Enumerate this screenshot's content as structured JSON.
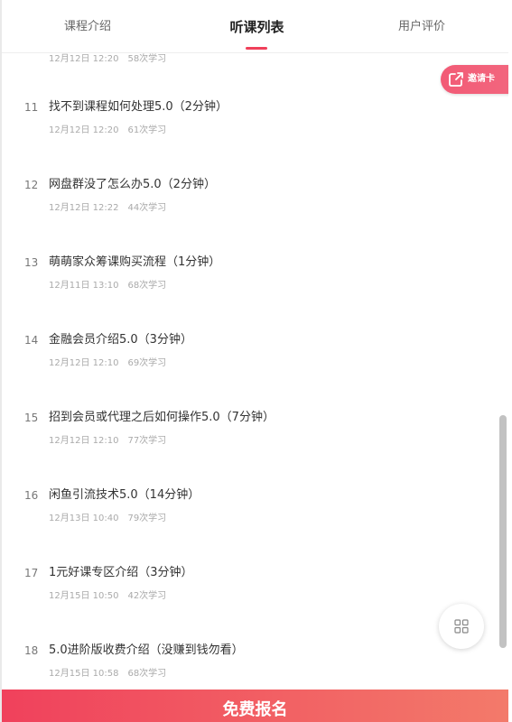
{
  "tabs": {
    "intro": "课程介绍",
    "list": "听课列表",
    "reviews": "用户评价",
    "active": "list"
  },
  "invite": {
    "label": "邀请卡",
    "icon": "share-icon"
  },
  "enroll": {
    "label": "免费报名"
  },
  "colors": {
    "accent": "#f0405a",
    "enroll_start": "#f0415c",
    "enroll_end": "#f37a6a"
  },
  "lessons": [
    {
      "num": "",
      "title": "",
      "date": "12月12日 12:20",
      "count": "58次学习"
    },
    {
      "num": "11",
      "title": "找不到课程如何处理5.0（2分钟）",
      "date": "12月12日 12:20",
      "count": "61次学习"
    },
    {
      "num": "12",
      "title": "网盘群没了怎么办5.0（2分钟）",
      "date": "12月12日 12:22",
      "count": "44次学习"
    },
    {
      "num": "13",
      "title": "萌萌家众筹课购买流程（1分钟）",
      "date": "12月11日 13:10",
      "count": "68次学习"
    },
    {
      "num": "14",
      "title": "金融会员介绍5.0（3分钟）",
      "date": "12月12日 12:10",
      "count": "69次学习"
    },
    {
      "num": "15",
      "title": "招到会员或代理之后如何操作5.0（7分钟）",
      "date": "12月12日 12:10",
      "count": "77次学习"
    },
    {
      "num": "16",
      "title": "闲鱼引流技术5.0（14分钟）",
      "date": "12月13日 10:40",
      "count": "79次学习"
    },
    {
      "num": "17",
      "title": "1元好课专区介绍（3分钟）",
      "date": "12月15日 10:50",
      "count": "42次学习"
    },
    {
      "num": "18",
      "title": "5.0进阶版收费介绍（没赚到钱勿看）",
      "date": "12月15日 10:58",
      "count": "68次学习"
    }
  ]
}
